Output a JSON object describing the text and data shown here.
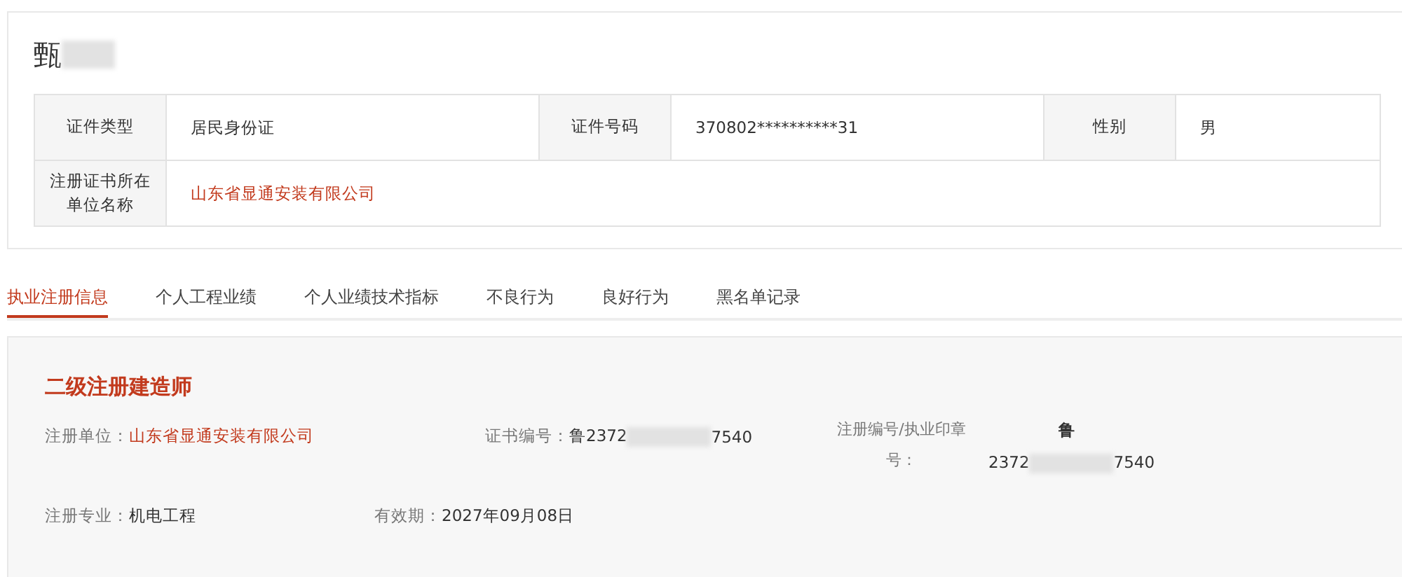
{
  "person": {
    "name": "甄",
    "name_redacted": true
  },
  "info_table": {
    "rows": [
      [
        {
          "label": "证件类型",
          "value": "居民身份证",
          "kind": "text"
        },
        {
          "label": "证件号码",
          "value": "370802**********31",
          "kind": "text"
        },
        {
          "label": "性别",
          "value": "男",
          "kind": "text"
        }
      ],
      [
        {
          "label": "注册证书所在单位名称",
          "value": "山东省显通安装有限公司",
          "kind": "link"
        }
      ]
    ]
  },
  "tabs": [
    {
      "label": "执业注册信息",
      "selected": true
    },
    {
      "label": "个人工程业绩",
      "selected": false
    },
    {
      "label": "个人业绩技术指标",
      "selected": false
    },
    {
      "label": "不良行为",
      "selected": false
    },
    {
      "label": "良好行为",
      "selected": false
    },
    {
      "label": "黑名单记录",
      "selected": false
    }
  ],
  "section": {
    "title": "二级注册建造师",
    "rows": [
      [
        {
          "label": "注册单位：",
          "kind": "link",
          "value": "山东省显通安装有限公司"
        },
        {
          "label": "证书编号：",
          "kind": "redacted",
          "before": "鲁2372",
          "after": "7540"
        },
        {
          "label": "注册编号/执业印章号：",
          "kind": "stacked",
          "prefix": "鲁",
          "before": "2372",
          "after": "7540"
        }
      ],
      [
        {
          "label": "注册专业：",
          "kind": "text",
          "value": "机电工程"
        },
        {
          "label": "有效期：",
          "kind": "text",
          "value": "2027年09月08日"
        }
      ]
    ]
  }
}
